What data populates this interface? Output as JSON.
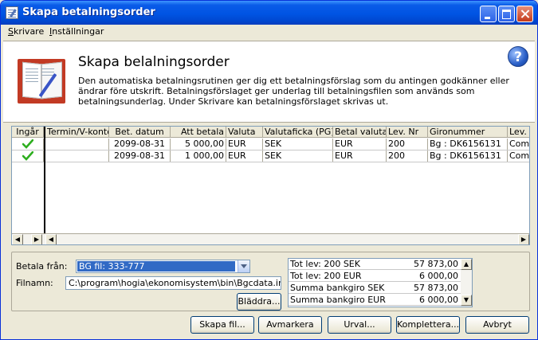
{
  "window": {
    "title": "Skapa betalningsorder"
  },
  "menu": {
    "items": [
      "Skrivare",
      "Inställningar"
    ]
  },
  "header": {
    "title": "Skapa belalningsorder",
    "description": "Den automatiska betalningsrutinen ger dig ett betalningsförslag som du antingen godkänner eller ändrar före utskrift. Betalningsförslaget ger underlag till betalningsfilen som används som betalningsunderlag. Under Skrivare kan betalningsförslaget skrivas ut.",
    "help_glyph": "?"
  },
  "grid": {
    "columns": [
      "Ingår",
      "Termin/V-konto",
      "Bet. datum",
      "Att betala",
      "Valuta",
      "Valutaficka (PG)",
      "Betal valuta",
      "Lev. Nr",
      "Gironummer",
      "Lev. I"
    ],
    "rows": [
      {
        "included": true,
        "termin": "",
        "bet_datum": "2099-08-31",
        "att_betala": "5 000,00",
        "valuta": "EUR",
        "valutaficka": "SEK",
        "betal_valuta": "EUR",
        "lev_nr": "200",
        "gironummer": "Bg : DK6156131",
        "lev": "Comp"
      },
      {
        "included": true,
        "termin": "",
        "bet_datum": "2099-08-31",
        "att_betala": "1 000,00",
        "valuta": "EUR",
        "valutaficka": "SEK",
        "betal_valuta": "EUR",
        "lev_nr": "200",
        "gironummer": "Bg : DK6156131",
        "lev": "Comp"
      }
    ]
  },
  "form": {
    "betala_fran_label": "Betala från:",
    "betala_fran_value": "BG fil: 333-777",
    "filnamn_label": "Filnamn:",
    "filnamn_value": "C:\\program\\hogia\\ekonomisystem\\bin\\Bgcdata.in",
    "browse_label": "Bläddra..."
  },
  "summary": [
    {
      "label": "Tot lev: 200 SEK",
      "value": "57 873,00"
    },
    {
      "label": "Tot lev: 200 EUR",
      "value": "6 000,00"
    },
    {
      "label": "Summa bankgiro SEK",
      "value": "57 873,00"
    },
    {
      "label": "Summa bankgiro EUR",
      "value": "6 000,00"
    }
  ],
  "buttons": {
    "create_file": "Skapa fil...",
    "unmark": "Avmarkera",
    "select": "Urval...",
    "complete": "Komplettera...",
    "cancel": "Avbryt"
  },
  "colors": {
    "titlebar": "#0054e3",
    "selection": "#316ac5",
    "check": "#2eae1f"
  }
}
